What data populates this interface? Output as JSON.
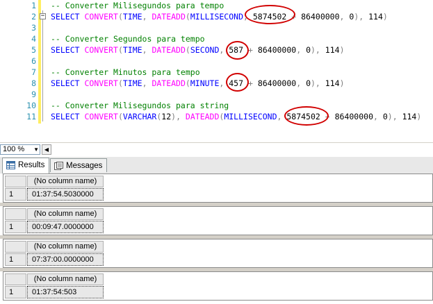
{
  "editor": {
    "line_numbers": [
      "1",
      "2",
      "3",
      "4",
      "5",
      "6",
      "7",
      "8",
      "9",
      "10",
      "11"
    ],
    "lines": [
      [
        {
          "t": "-- Converter Milisegundos para tempo",
          "c": "cm"
        }
      ],
      [
        {
          "t": "SELECT ",
          "c": "kw"
        },
        {
          "t": "CONVERT",
          "c": "fn"
        },
        {
          "t": "(",
          "c": "gr"
        },
        {
          "t": "TIME",
          "c": "kw"
        },
        {
          "t": ", ",
          "c": "gr"
        },
        {
          "t": "DATEADD",
          "c": "fn"
        },
        {
          "t": "(",
          "c": "gr"
        },
        {
          "t": "MILLISECOND",
          "c": "kw"
        },
        {
          "t": ", ",
          "c": "gr"
        },
        {
          "t": "5874502",
          "c": ""
        },
        {
          "t": " + ",
          "c": "gr"
        },
        {
          "t": "86400000",
          "c": ""
        },
        {
          "t": ", ",
          "c": "gr"
        },
        {
          "t": "0",
          "c": ""
        },
        {
          "t": "), ",
          "c": "gr"
        },
        {
          "t": "114",
          "c": ""
        },
        {
          "t": ")",
          "c": "gr"
        }
      ],
      [],
      [
        {
          "t": "-- Converter Segundos para tempo",
          "c": "cm"
        }
      ],
      [
        {
          "t": "SELECT ",
          "c": "kw"
        },
        {
          "t": "CONVERT",
          "c": "fn"
        },
        {
          "t": "(",
          "c": "gr"
        },
        {
          "t": "TIME",
          "c": "kw"
        },
        {
          "t": ", ",
          "c": "gr"
        },
        {
          "t": "DATEADD",
          "c": "fn"
        },
        {
          "t": "(",
          "c": "gr"
        },
        {
          "t": "SECOND",
          "c": "kw"
        },
        {
          "t": ", ",
          "c": "gr"
        },
        {
          "t": "587",
          "c": ""
        },
        {
          "t": " + ",
          "c": "gr"
        },
        {
          "t": "86400000",
          "c": ""
        },
        {
          "t": ", ",
          "c": "gr"
        },
        {
          "t": "0",
          "c": ""
        },
        {
          "t": "), ",
          "c": "gr"
        },
        {
          "t": "114",
          "c": ""
        },
        {
          "t": ")",
          "c": "gr"
        }
      ],
      [],
      [
        {
          "t": "-- Converter Minutos para tempo",
          "c": "cm"
        }
      ],
      [
        {
          "t": "SELECT ",
          "c": "kw"
        },
        {
          "t": "CONVERT",
          "c": "fn"
        },
        {
          "t": "(",
          "c": "gr"
        },
        {
          "t": "TIME",
          "c": "kw"
        },
        {
          "t": ", ",
          "c": "gr"
        },
        {
          "t": "DATEADD",
          "c": "fn"
        },
        {
          "t": "(",
          "c": "gr"
        },
        {
          "t": "MINUTE",
          "c": "kw"
        },
        {
          "t": ", ",
          "c": "gr"
        },
        {
          "t": "457",
          "c": ""
        },
        {
          "t": " + ",
          "c": "gr"
        },
        {
          "t": "86400000",
          "c": ""
        },
        {
          "t": ", ",
          "c": "gr"
        },
        {
          "t": "0",
          "c": ""
        },
        {
          "t": "), ",
          "c": "gr"
        },
        {
          "t": "114",
          "c": ""
        },
        {
          "t": ")",
          "c": "gr"
        }
      ],
      [],
      [
        {
          "t": "-- Converter Milisegundos para string",
          "c": "cm"
        }
      ],
      [
        {
          "t": "SELECT ",
          "c": "kw"
        },
        {
          "t": "CONVERT",
          "c": "fn"
        },
        {
          "t": "(",
          "c": "gr"
        },
        {
          "t": "VARCHAR",
          "c": "kw"
        },
        {
          "t": "(",
          "c": "gr"
        },
        {
          "t": "12",
          "c": ""
        },
        {
          "t": "), ",
          "c": "gr"
        },
        {
          "t": "DATEADD",
          "c": "fn"
        },
        {
          "t": "(",
          "c": "gr"
        },
        {
          "t": "MILLISECOND",
          "c": "kw"
        },
        {
          "t": ", ",
          "c": "gr"
        },
        {
          "t": "5874502",
          "c": ""
        },
        {
          "t": " + ",
          "c": "gr"
        },
        {
          "t": "86400000",
          "c": ""
        },
        {
          "t": ", ",
          "c": "gr"
        },
        {
          "t": "0",
          "c": ""
        },
        {
          "t": "), ",
          "c": "gr"
        },
        {
          "t": "114",
          "c": ""
        },
        {
          "t": ")",
          "c": "gr"
        }
      ]
    ],
    "colors": {
      "keyword": "#0000ff",
      "function": "#ff00ff",
      "operator": "#808080",
      "comment": "#008000",
      "line_number": "#2b91af",
      "highlight_circle": "#d10000",
      "change_bar": "#ffee62"
    }
  },
  "zoom": {
    "value": "100 %"
  },
  "tabs": {
    "results": "Results",
    "messages": "Messages"
  },
  "results": [
    {
      "column": "(No column name)",
      "row": "1",
      "value": "01:37:54.5030000"
    },
    {
      "column": "(No column name)",
      "row": "1",
      "value": "00:09:47.0000000"
    },
    {
      "column": "(No column name)",
      "row": "1",
      "value": "07:37:00.0000000"
    },
    {
      "column": "(No column name)",
      "row": "1",
      "value": "01:37:54:503"
    }
  ]
}
